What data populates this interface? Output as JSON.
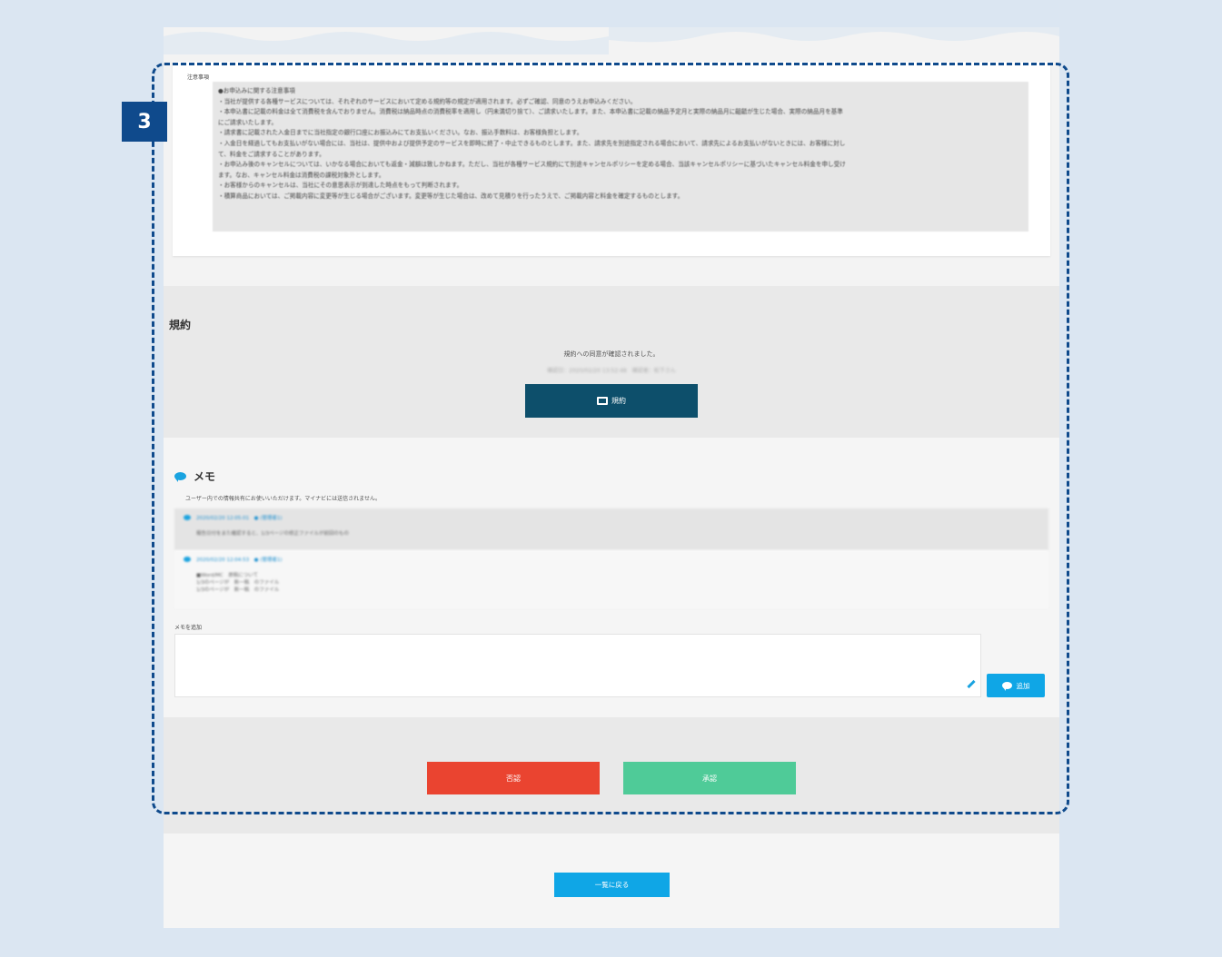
{
  "notes": {
    "heading": "注意事項",
    "lines": [
      "●お申込みに関する注意事項",
      "・当社が提供する各種サービスについては、それぞれのサービスにおいて定める規約等の規定が適用されます。必ずご確認、同意のうえお申込みください。",
      "・本申込書に記載の料金は全て消費税を含んでおりません。消費税は納品時点の消費税率を適用し（円未満切り捨て）、ご請求いたします。また、本申込書に記載の納品予定月と実際の納品月に齟齬が生じた場合、実際の納品月を基準",
      "にご請求いたします。",
      "・請求書に記載された入金日までに当社指定の銀行口座にお振込みにてお支払いください。なお、振込手数料は、お客様負担とします。",
      "・入金日を経過してもお支払いがない場合には、当社は、提供中および提供予定のサービスを即時に終了・中止できるものとします。また、請求先を別途指定される場合において、請求先によるお支払いがないときには、お客様に対し",
      "て、料金をご請求することがあります。",
      "・お申込み後のキャンセルについては、いかなる場合においても返金・減額は致しかねます。ただし、当社が各種サービス規約にて別途キャンセルポリシーを定める場合、当該キャンセルポリシーに基づいたキャンセル料金を申し受け",
      "ます。なお、キャンセル料金は消費税の課税対象外とします。",
      "・お客様からのキャンセルは、当社にその意思表示が到達した時点をもって判断されます。",
      "・積算商品においては、ご掲載内容に変更等が生じる場合がございます。変更等が生じた場合は、改めて見積りを行ったうえで、ご掲載内容と料金を確定するものとします。"
    ]
  },
  "terms": {
    "title": "規約",
    "status": "規約への同意が確認されました。",
    "meta": "確認日：2020/02/20 13:52:48　確認者：松下さん",
    "button_label": "規約"
  },
  "memo": {
    "title": "メモ",
    "description": "ユーザー内での情報共有にお使いいただけます。マイナビには送信されません。",
    "entries": [
      {
        "meta": "2020/02/20 12:05:01　● (管理者1)",
        "body": "報告日付をまた確認すると、1/3ページの修正ファイルが前回のもの"
      },
      {
        "meta": "2020/02/20 12:04:53　● (管理者1)",
        "body": "■Word/MC　原稿について\n1/3のページが　新一稿　のファイル\n1/3のページが　新一稿　のファイル"
      }
    ],
    "add_label": "メモを追加",
    "textarea_placeholder": "",
    "add_button_label": "追加"
  },
  "actions": {
    "reject_label": "否認",
    "approve_label": "承認"
  },
  "footer": {
    "back_label": "一覧に戻る"
  },
  "overlay": {
    "step_number": "3"
  },
  "colors": {
    "background": "#dbe6f2",
    "terms_button": "#0d4f6b",
    "reject": "#ea4430",
    "approve": "#4fcb98",
    "primary": "#0fa6e6",
    "highlight_border": "#0f4a8c"
  }
}
